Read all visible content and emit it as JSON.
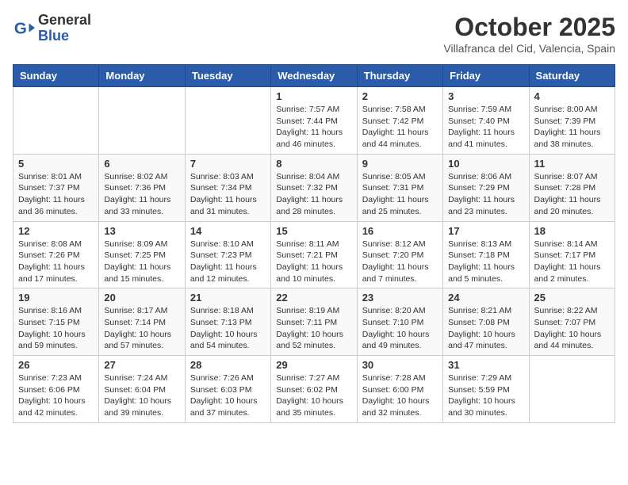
{
  "header": {
    "logo_general": "General",
    "logo_blue": "Blue",
    "month": "October 2025",
    "location": "Villafranca del Cid, Valencia, Spain"
  },
  "weekdays": [
    "Sunday",
    "Monday",
    "Tuesday",
    "Wednesday",
    "Thursday",
    "Friday",
    "Saturday"
  ],
  "weeks": [
    [
      {
        "day": "",
        "info": ""
      },
      {
        "day": "",
        "info": ""
      },
      {
        "day": "",
        "info": ""
      },
      {
        "day": "1",
        "info": "Sunrise: 7:57 AM\nSunset: 7:44 PM\nDaylight: 11 hours\nand 46 minutes."
      },
      {
        "day": "2",
        "info": "Sunrise: 7:58 AM\nSunset: 7:42 PM\nDaylight: 11 hours\nand 44 minutes."
      },
      {
        "day": "3",
        "info": "Sunrise: 7:59 AM\nSunset: 7:40 PM\nDaylight: 11 hours\nand 41 minutes."
      },
      {
        "day": "4",
        "info": "Sunrise: 8:00 AM\nSunset: 7:39 PM\nDaylight: 11 hours\nand 38 minutes."
      }
    ],
    [
      {
        "day": "5",
        "info": "Sunrise: 8:01 AM\nSunset: 7:37 PM\nDaylight: 11 hours\nand 36 minutes."
      },
      {
        "day": "6",
        "info": "Sunrise: 8:02 AM\nSunset: 7:36 PM\nDaylight: 11 hours\nand 33 minutes."
      },
      {
        "day": "7",
        "info": "Sunrise: 8:03 AM\nSunset: 7:34 PM\nDaylight: 11 hours\nand 31 minutes."
      },
      {
        "day": "8",
        "info": "Sunrise: 8:04 AM\nSunset: 7:32 PM\nDaylight: 11 hours\nand 28 minutes."
      },
      {
        "day": "9",
        "info": "Sunrise: 8:05 AM\nSunset: 7:31 PM\nDaylight: 11 hours\nand 25 minutes."
      },
      {
        "day": "10",
        "info": "Sunrise: 8:06 AM\nSunset: 7:29 PM\nDaylight: 11 hours\nand 23 minutes."
      },
      {
        "day": "11",
        "info": "Sunrise: 8:07 AM\nSunset: 7:28 PM\nDaylight: 11 hours\nand 20 minutes."
      }
    ],
    [
      {
        "day": "12",
        "info": "Sunrise: 8:08 AM\nSunset: 7:26 PM\nDaylight: 11 hours\nand 17 minutes."
      },
      {
        "day": "13",
        "info": "Sunrise: 8:09 AM\nSunset: 7:25 PM\nDaylight: 11 hours\nand 15 minutes."
      },
      {
        "day": "14",
        "info": "Sunrise: 8:10 AM\nSunset: 7:23 PM\nDaylight: 11 hours\nand 12 minutes."
      },
      {
        "day": "15",
        "info": "Sunrise: 8:11 AM\nSunset: 7:21 PM\nDaylight: 11 hours\nand 10 minutes."
      },
      {
        "day": "16",
        "info": "Sunrise: 8:12 AM\nSunset: 7:20 PM\nDaylight: 11 hours\nand 7 minutes."
      },
      {
        "day": "17",
        "info": "Sunrise: 8:13 AM\nSunset: 7:18 PM\nDaylight: 11 hours\nand 5 minutes."
      },
      {
        "day": "18",
        "info": "Sunrise: 8:14 AM\nSunset: 7:17 PM\nDaylight: 11 hours\nand 2 minutes."
      }
    ],
    [
      {
        "day": "19",
        "info": "Sunrise: 8:16 AM\nSunset: 7:15 PM\nDaylight: 10 hours\nand 59 minutes."
      },
      {
        "day": "20",
        "info": "Sunrise: 8:17 AM\nSunset: 7:14 PM\nDaylight: 10 hours\nand 57 minutes."
      },
      {
        "day": "21",
        "info": "Sunrise: 8:18 AM\nSunset: 7:13 PM\nDaylight: 10 hours\nand 54 minutes."
      },
      {
        "day": "22",
        "info": "Sunrise: 8:19 AM\nSunset: 7:11 PM\nDaylight: 10 hours\nand 52 minutes."
      },
      {
        "day": "23",
        "info": "Sunrise: 8:20 AM\nSunset: 7:10 PM\nDaylight: 10 hours\nand 49 minutes."
      },
      {
        "day": "24",
        "info": "Sunrise: 8:21 AM\nSunset: 7:08 PM\nDaylight: 10 hours\nand 47 minutes."
      },
      {
        "day": "25",
        "info": "Sunrise: 8:22 AM\nSunset: 7:07 PM\nDaylight: 10 hours\nand 44 minutes."
      }
    ],
    [
      {
        "day": "26",
        "info": "Sunrise: 7:23 AM\nSunset: 6:06 PM\nDaylight: 10 hours\nand 42 minutes."
      },
      {
        "day": "27",
        "info": "Sunrise: 7:24 AM\nSunset: 6:04 PM\nDaylight: 10 hours\nand 39 minutes."
      },
      {
        "day": "28",
        "info": "Sunrise: 7:26 AM\nSunset: 6:03 PM\nDaylight: 10 hours\nand 37 minutes."
      },
      {
        "day": "29",
        "info": "Sunrise: 7:27 AM\nSunset: 6:02 PM\nDaylight: 10 hours\nand 35 minutes."
      },
      {
        "day": "30",
        "info": "Sunrise: 7:28 AM\nSunset: 6:00 PM\nDaylight: 10 hours\nand 32 minutes."
      },
      {
        "day": "31",
        "info": "Sunrise: 7:29 AM\nSunset: 5:59 PM\nDaylight: 10 hours\nand 30 minutes."
      },
      {
        "day": "",
        "info": ""
      }
    ]
  ]
}
